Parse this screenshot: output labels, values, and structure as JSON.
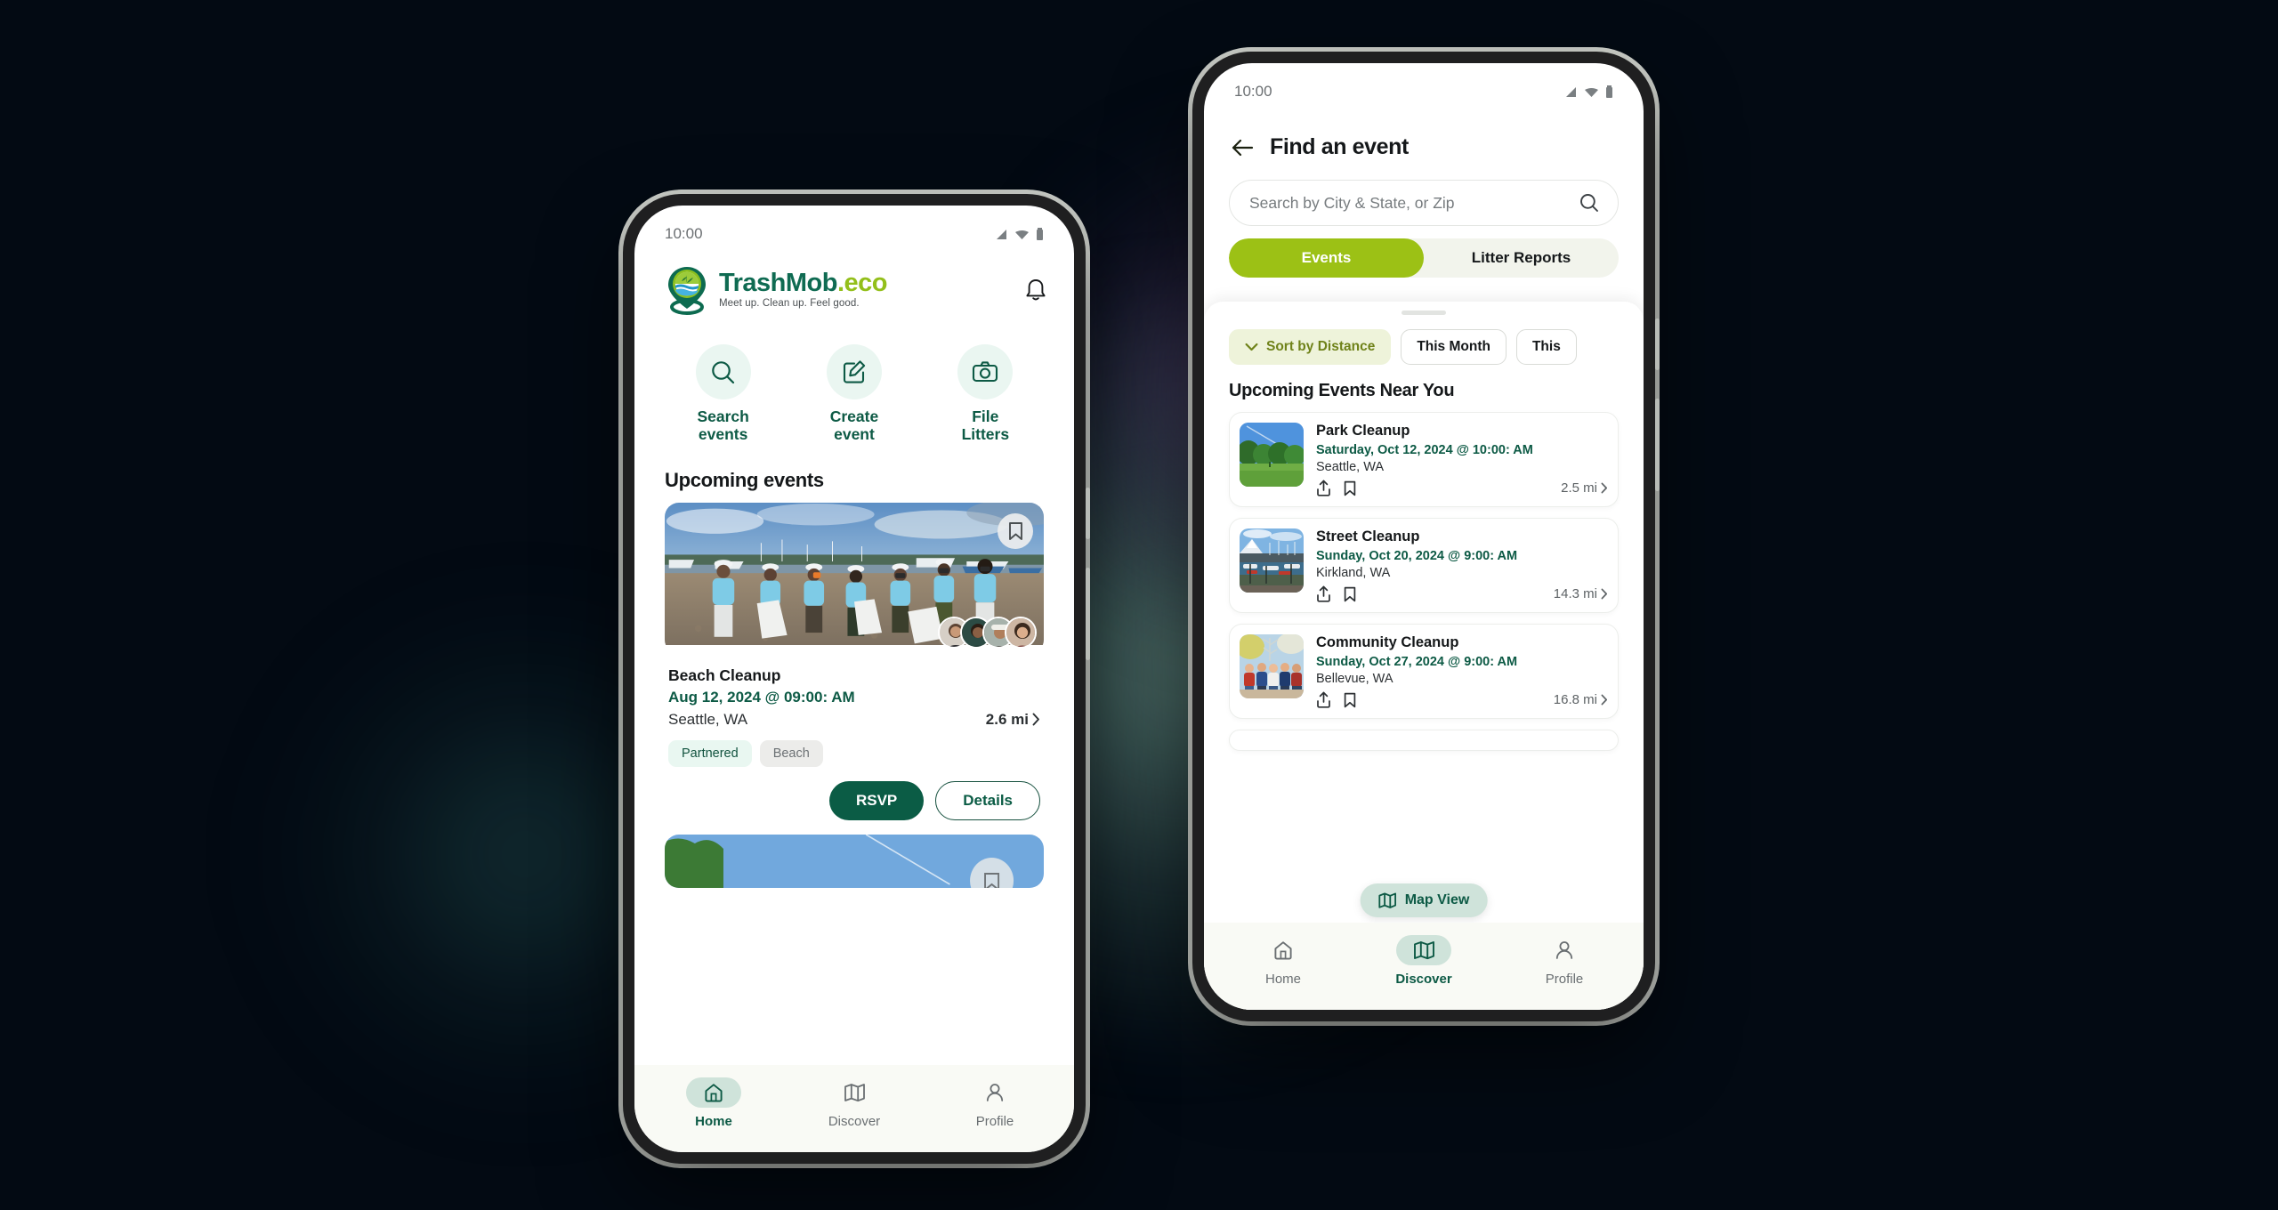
{
  "background": {
    "base_color": "#030a13",
    "glow_mint": "#96cdb9",
    "glow_purple": "#785596"
  },
  "brand_colors": {
    "dark_green": "#0d5a45",
    "lime": "#9cc115",
    "mint": "#cfe3da",
    "mint_light": "#eaf6f1"
  },
  "phone_home": {
    "status": {
      "time": "10:00",
      "icons": [
        "signal-icon",
        "wifi-icon",
        "battery-icon"
      ]
    },
    "brand": {
      "name_part1": "TrashMob",
      "name_part2": ".eco",
      "tagline": "Meet up. Clean up. Feel good.",
      "logo_icon": "trashmob-pin-logo",
      "bell_icon": "notification-bell-icon"
    },
    "quick_actions": [
      {
        "icon": "search-icon",
        "label": "Search\nevents",
        "line1": "Search",
        "line2": "events"
      },
      {
        "icon": "edit-square-icon",
        "label": "Create event",
        "line1": "Create",
        "line2": "event"
      },
      {
        "icon": "camera-icon",
        "label": "File Litters",
        "line1": "File",
        "line2": "Litters"
      }
    ],
    "section_title": "Upcoming events",
    "event_card": {
      "title": "Beach Cleanup",
      "date": "Aug 12, 2024 @ 09:00: AM",
      "location": "Seattle, WA",
      "distance": "2.6 mi",
      "chevron": "›",
      "bookmark_icon": "bookmark-icon",
      "tags": [
        {
          "label": "Partnered",
          "style": "partnered"
        },
        {
          "label": "Beach",
          "style": "plain"
        }
      ],
      "primary_button": "RSVP",
      "secondary_button": "Details",
      "attendee_avatar_count": 4,
      "image_alt": "volunteers-beach-cleanup-photo"
    },
    "bottom_nav": [
      {
        "icon": "home-icon",
        "label": "Home",
        "active": true
      },
      {
        "icon": "map-icon",
        "label": "Discover",
        "active": false
      },
      {
        "icon": "person-icon",
        "label": "Profile",
        "active": false
      }
    ]
  },
  "phone_discover": {
    "status": {
      "time": "10:00",
      "icons": [
        "signal-icon",
        "wifi-icon",
        "battery-icon"
      ]
    },
    "header": {
      "back_icon": "back-arrow-icon",
      "title": "Find an event"
    },
    "search": {
      "placeholder": "Search by City & State, or Zip",
      "icon": "search-icon"
    },
    "tabs": [
      {
        "label": "Events",
        "active": true
      },
      {
        "label": "Litter Reports",
        "active": false
      }
    ],
    "filter_chips": [
      {
        "label": "Sort by Distance",
        "icon": "chevron-down-icon",
        "active": true
      },
      {
        "label": "This Month",
        "active": false
      },
      {
        "label": "This",
        "active": false
      }
    ],
    "list_title": "Upcoming Events Near You",
    "events": [
      {
        "title": "Park Cleanup",
        "date": "Saturday, Oct 12, 2024 @ 10:00: AM",
        "location": "Seattle, WA",
        "distance": "2.5 mi",
        "chevron": "›",
        "thumb": "park-green-trees-photo",
        "share_icon": "share-icon",
        "bookmark_icon": "bookmark-icon"
      },
      {
        "title": "Street Cleanup",
        "date": "Sunday, Oct 20, 2024 @ 9:00: AM",
        "location": "Kirkland, WA",
        "distance": "14.3 mi",
        "chevron": "›",
        "thumb": "marina-boats-mountain-photo",
        "share_icon": "share-icon",
        "bookmark_icon": "bookmark-icon"
      },
      {
        "title": "Community Cleanup",
        "date": "Sunday, Oct 27, 2024 @ 9:00: AM",
        "location": "Bellevue, WA",
        "distance": "16.8 mi",
        "chevron": "›",
        "thumb": "group-people-sitting-photo",
        "share_icon": "share-icon",
        "bookmark_icon": "bookmark-icon"
      }
    ],
    "map_fab": {
      "label": "Map View",
      "icon": "map-icon"
    },
    "bottom_nav": [
      {
        "icon": "home-icon",
        "label": "Home",
        "active": false
      },
      {
        "icon": "map-icon",
        "label": "Discover",
        "active": true
      },
      {
        "icon": "person-icon",
        "label": "Profile",
        "active": false
      }
    ]
  }
}
